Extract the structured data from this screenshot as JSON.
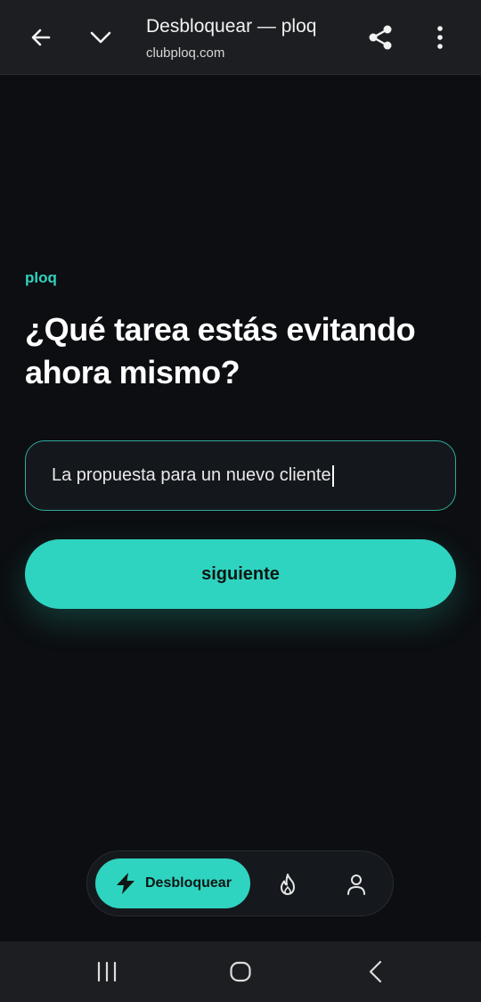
{
  "browser": {
    "title": "Desbloquear — ploq",
    "url": "clubploq.com",
    "icons": [
      "back-arrow-icon",
      "chevron-down-icon",
      "share-icon",
      "more-vert-icon"
    ]
  },
  "main": {
    "brand": "ploq",
    "heading": "¿Qué tarea estás evitando ahora mismo?",
    "input_value": "La propuesta para un nuevo cliente",
    "next_label": "siguiente"
  },
  "tabbar": {
    "active_label": "Desbloquear",
    "icons": [
      "bolt-icon",
      "flame-icon",
      "profile-icon"
    ]
  },
  "navbar": {
    "icons": [
      "recents-icon",
      "home-icon",
      "back-icon"
    ]
  },
  "colors": {
    "accent": "#2fd4c0",
    "background": "#0c0e11",
    "bar": "#1c1e21"
  }
}
